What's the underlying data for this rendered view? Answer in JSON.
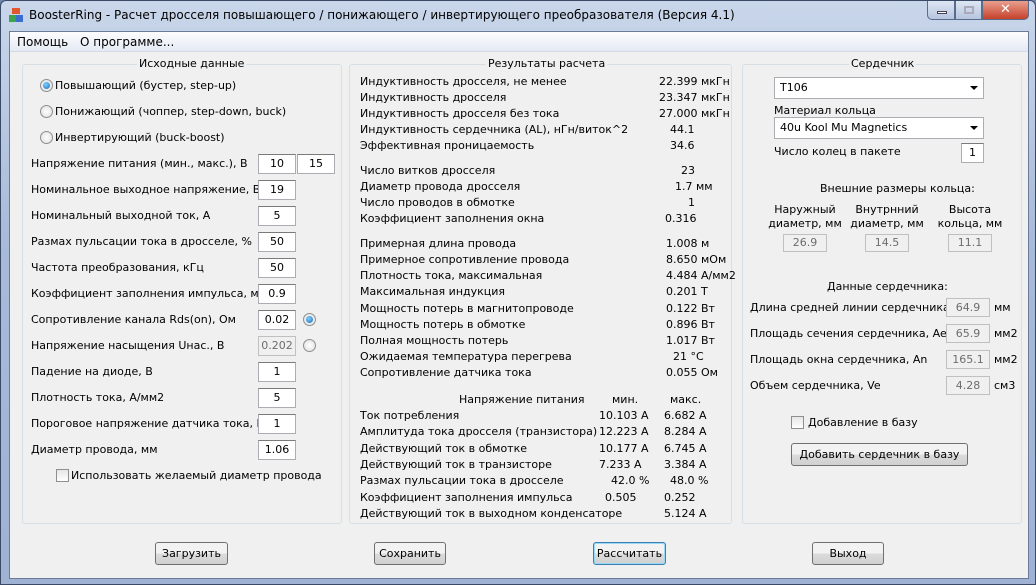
{
  "window": {
    "title": "BoosterRing - Расчет дросселя повышающего / понижающего / инвертирующего преобразователя (Версия 4.1)"
  },
  "menu": [
    "Помощь",
    "О программе..."
  ],
  "input_group": {
    "title": "Исходные данные",
    "modes": [
      {
        "label": "Повышающий (бустер, step-up)",
        "selected": true
      },
      {
        "label": "Понижающий (чоппер, step-down, buck)",
        "selected": false
      },
      {
        "label": "Инвертирующий (buck-boost)",
        "selected": false
      }
    ],
    "fields": [
      {
        "label": "Напряжение питания (мин.,  макс.), В",
        "value": "10",
        "value2": "15"
      },
      {
        "label": "Номинальное выходное напряжение, В",
        "value": "19"
      },
      {
        "label": "Номинальный выходной ток, А",
        "value": "5"
      },
      {
        "label": "Размах пульсации тока в дросселе, %",
        "value": "50"
      },
      {
        "label": "Частота преобразования, кГц",
        "value": "50"
      },
      {
        "label": "Коэффициент заполнения импульса, макс.",
        "value": "0.9"
      },
      {
        "label": "Сопротивление канала Rds(on), Ом",
        "value": "0.02",
        "radio": true
      },
      {
        "label": "Напряжение насыщения Uнас., В",
        "value": "0.202",
        "radio": false,
        "disabled": true
      },
      {
        "label": "Падение на диоде, В",
        "value": "1"
      },
      {
        "label": "Плотность тока, А/мм2",
        "value": "5"
      },
      {
        "label": "Пороговое напряжение датчика тока, В",
        "value": "1"
      },
      {
        "label": "Диаметр провода, мм",
        "value": "1.06"
      }
    ],
    "use_diameter": {
      "label": "Использовать желаемый диаметр провода",
      "checked": false
    }
  },
  "results": {
    "title": "Результаты расчета",
    "rows": [
      {
        "label": "Индуктивность дросселя, не менее",
        "value": "22.399 мкГн"
      },
      {
        "label": "Индуктивность дросселя",
        "value": "23.347 мкГн"
      },
      {
        "label": "Индуктивность дросселя без тока",
        "value": "27.000 мкГн"
      },
      {
        "label": "Индуктивность сердечника (AL), нГн/виток^2",
        "value": "44.1"
      },
      {
        "label": "Эффективная проницаемость",
        "value": "34.6"
      },
      {
        "label": "Число витков дросселя",
        "value": "23"
      },
      {
        "label": "Диаметр провода дросселя",
        "value": "1.7 мм"
      },
      {
        "label": "Число проводов в обмотке",
        "value": "1"
      },
      {
        "label": "Коэффициент заполнения окна",
        "value": "0.316"
      },
      {
        "label": "Примерная длина провода",
        "value": "1.008 м"
      },
      {
        "label": "Примерное сопротивление провода",
        "value": "8.650 мОм"
      },
      {
        "label": "Плотность тока, максимальная",
        "value": "4.484 А/мм2"
      },
      {
        "label": "Максимальная индукция",
        "value": "0.201 Т"
      },
      {
        "label": "Мощность потерь в магнитопроводе",
        "value": "0.122 Вт"
      },
      {
        "label": "Мощность потерь в обмотке",
        "value": "0.896 Вт"
      },
      {
        "label": "Полная мощность потерь",
        "value": "1.017 Вт"
      },
      {
        "label": "Ожидаемая температура перегрева",
        "value": "21 °C"
      },
      {
        "label": "Сопротивление датчика тока",
        "value": "0.055 Ом"
      }
    ],
    "supply_table": {
      "header": "Напряжение питания",
      "min": "мин.",
      "max": "макс.",
      "rows": [
        {
          "label": "Ток потребления",
          "min": "10.103 А",
          "max": "6.682 А"
        },
        {
          "label": "Амплитуда тока дросселя (транзистора)",
          "min": "12.223 А",
          "max": "8.284 А"
        },
        {
          "label": "Действующий ток в обмотке",
          "min": "10.177 А",
          "max": "6.745 А"
        },
        {
          "label": "Действующий ток в транзисторе",
          "min": "7.233 А",
          "max": "3.384 А"
        },
        {
          "label": "Размах пульсации тока в дросселе",
          "min": "42.0 %",
          "max": "48.0 %"
        },
        {
          "label": "Коэффициент заполнения импульса",
          "min": "0.505",
          "max": "0.252"
        },
        {
          "label": "Действующий ток в выходном конденсаторе",
          "min": "",
          "max": "5.124 А"
        }
      ]
    }
  },
  "core": {
    "title": "Сердечник",
    "core_type": "T106",
    "material_label": "Материал кольца",
    "material": "40u Kool Mu Magnetics",
    "rings_label": "Число колец в пакете",
    "rings": "1",
    "dims_title": "Внешние размеры кольца:",
    "dims": [
      {
        "l1": "Наружный",
        "l2": "диаметр, мм",
        "value": "26.9"
      },
      {
        "l1": "Внутрнний",
        "l2": "диаметр, мм",
        "value": "14.5"
      },
      {
        "l1": "Высота",
        "l2": "кольца, мм",
        "value": "11.1"
      }
    ],
    "data_title": "Данные сердечника:",
    "data": [
      {
        "label": "Длина средней линии сердечника, le",
        "value": "64.9",
        "unit": "мм"
      },
      {
        "label": "Площадь сечения сердечника, Ae",
        "value": "65.9",
        "unit": "мм2"
      },
      {
        "label": "Площадь окна сердечника, An",
        "value": "165.1",
        "unit": "мм2"
      },
      {
        "label": "Объем сердечника, Ve",
        "value": "4.28",
        "unit": "см3"
      }
    ],
    "add_to_db": {
      "label": "Добавление в базу",
      "checked": false
    },
    "add_button": "Добавить сердечник в базу"
  },
  "buttons": {
    "load": "Загрузить",
    "save": "Сохранить",
    "calc": "Рассчитать",
    "exit": "Выход"
  }
}
